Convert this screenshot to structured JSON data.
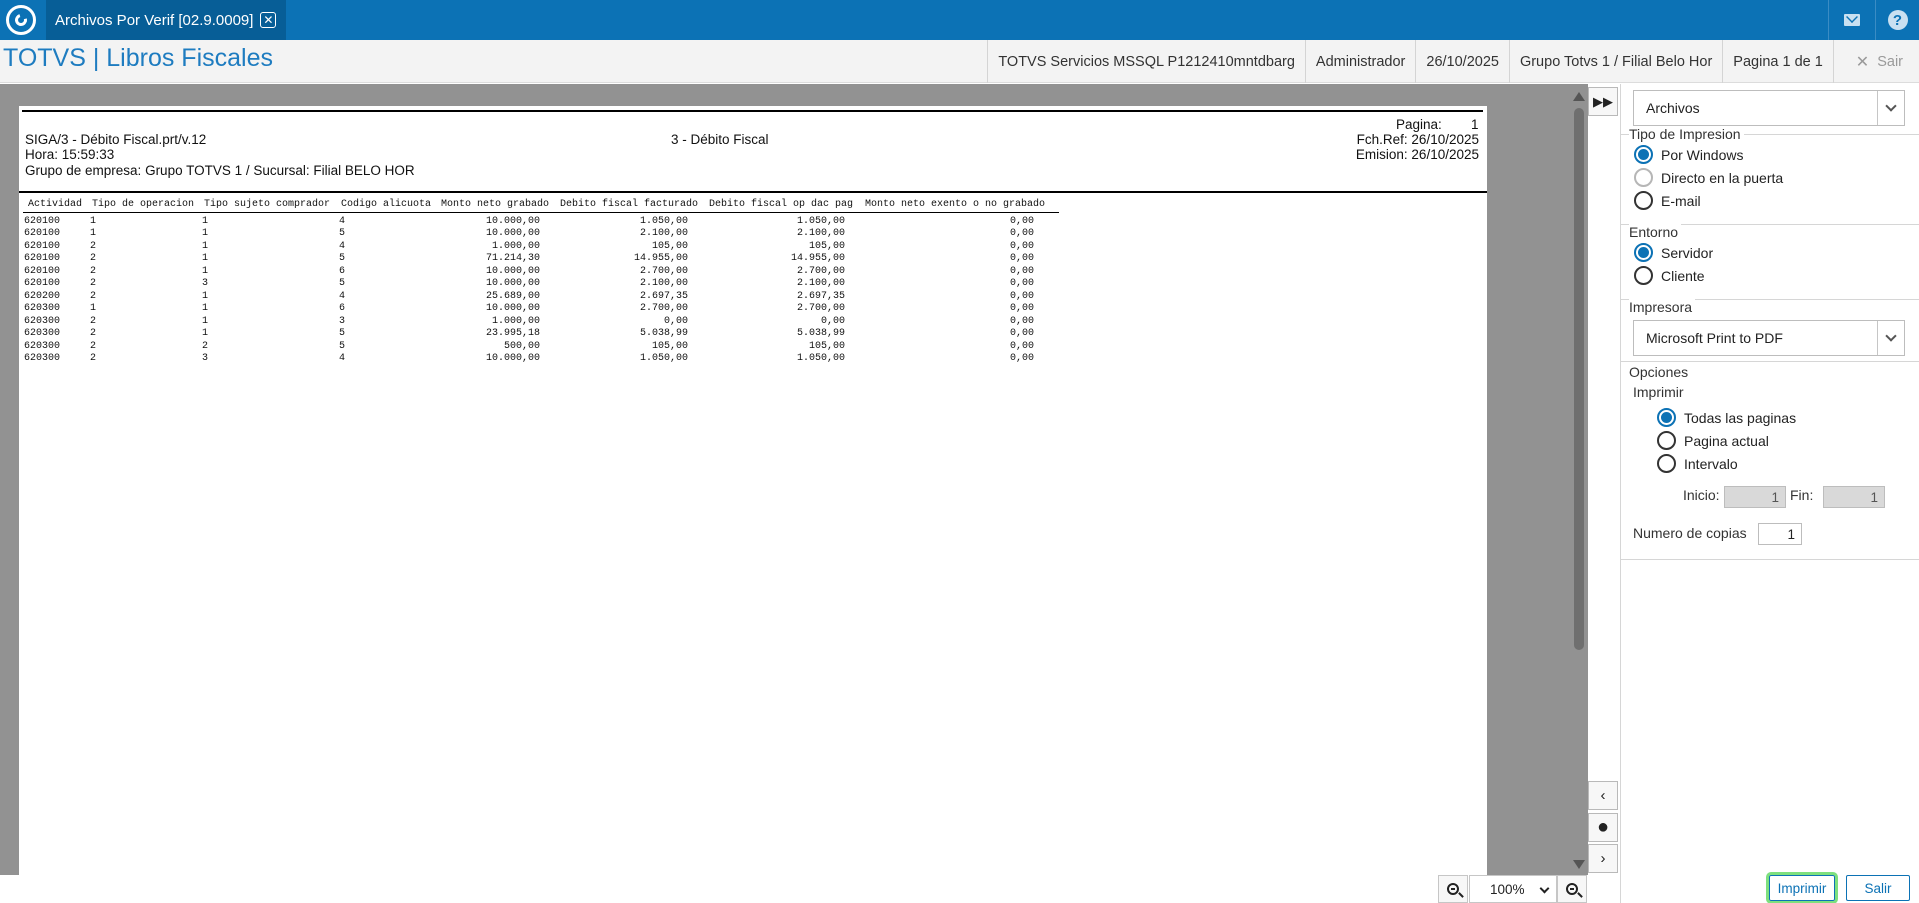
{
  "topbar": {
    "tab_title": "Archivos Por Verif [02.9.0009]",
    "icons": {
      "logo": "totvs-logo-icon",
      "close": "close-icon",
      "mail": "mail-icon",
      "help": "help-icon"
    }
  },
  "header": {
    "app_title": "TOTVS | Libros Fiscales",
    "status": {
      "connection": "TOTVS Servicios MSSQL P1212410mntdbarg",
      "user": "Administrador",
      "date": "26/10/2025",
      "branch": "Grupo Totvs 1 / Filial Belo Hor",
      "page": "Pagina 1 de 1",
      "exit": "Sair"
    }
  },
  "report": {
    "program": "SIGA/3 - Débito Fiscal.prt/v.12",
    "time": "Hora: 15:59:33",
    "group": "Grupo de empresa: Grupo TOTVS 1 / Sucursal: Filial BELO HOR",
    "title": "3 - Débito Fiscal",
    "page_label": "Pagina:",
    "page_value": "1",
    "fch_ref": "Fch.Ref: 26/10/2025",
    "emision": "Emision: 26/10/2025",
    "columns": [
      "Actividad",
      "Tipo de operacion",
      "Tipo sujeto comprador",
      "Codigo alicuota",
      "Monto neto grabado",
      "Debito fiscal facturado",
      "Debito fiscal op dac pag",
      "Monto neto exento o no grabado"
    ],
    "rows": [
      [
        "620100",
        "1",
        "1",
        "4",
        "10.000,00",
        "1.050,00",
        "1.050,00",
        "0,00"
      ],
      [
        "620100",
        "1",
        "1",
        "5",
        "10.000,00",
        "2.100,00",
        "2.100,00",
        "0,00"
      ],
      [
        "620100",
        "2",
        "1",
        "4",
        "1.000,00",
        "105,00",
        "105,00",
        "0,00"
      ],
      [
        "620100",
        "2",
        "1",
        "5",
        "71.214,30",
        "14.955,00",
        "14.955,00",
        "0,00"
      ],
      [
        "620100",
        "2",
        "1",
        "6",
        "10.000,00",
        "2.700,00",
        "2.700,00",
        "0,00"
      ],
      [
        "620100",
        "2",
        "3",
        "5",
        "10.000,00",
        "2.100,00",
        "2.100,00",
        "0,00"
      ],
      [
        "620200",
        "2",
        "1",
        "4",
        "25.689,00",
        "2.697,35",
        "2.697,35",
        "0,00"
      ],
      [
        "620300",
        "1",
        "1",
        "6",
        "10.000,00",
        "2.700,00",
        "2.700,00",
        "0,00"
      ],
      [
        "620300",
        "2",
        "1",
        "3",
        "1.000,00",
        "0,00",
        "0,00",
        "0,00"
      ],
      [
        "620300",
        "2",
        "1",
        "5",
        "23.995,18",
        "5.038,99",
        "5.038,99",
        "0,00"
      ],
      [
        "620300",
        "2",
        "2",
        "5",
        "500,00",
        "105,00",
        "105,00",
        "0,00"
      ],
      [
        "620300",
        "2",
        "3",
        "4",
        "10.000,00",
        "1.050,00",
        "1.050,00",
        "0,00"
      ]
    ]
  },
  "zoom": {
    "value": "100%"
  },
  "panel": {
    "destino": "Archivos",
    "tipo_label": "Tipo de Impresion",
    "tipo_options": [
      "Por Windows",
      "Directo en la puerta",
      "E-mail"
    ],
    "tipo_selected": 0,
    "entorno_label": "Entorno",
    "entorno_options": [
      "Servidor",
      "Cliente"
    ],
    "entorno_selected": 0,
    "impresora_label": "Impresora",
    "impresora": "Microsoft Print to PDF",
    "opciones_label": "Opciones",
    "imprimir_label": "Imprimir",
    "imprimir_options": [
      "Todas las paginas",
      "Pagina actual",
      "Intervalo"
    ],
    "imprimir_selected": 0,
    "inicio_label": "Inicio:",
    "inicio_value": "1",
    "fin_label": "Fin:",
    "fin_value": "1",
    "copias_label": "Numero de copias",
    "copias_value": "1",
    "print_button": "Imprimir",
    "exit_button": "Salir"
  },
  "accent_color": "#0c72b5"
}
